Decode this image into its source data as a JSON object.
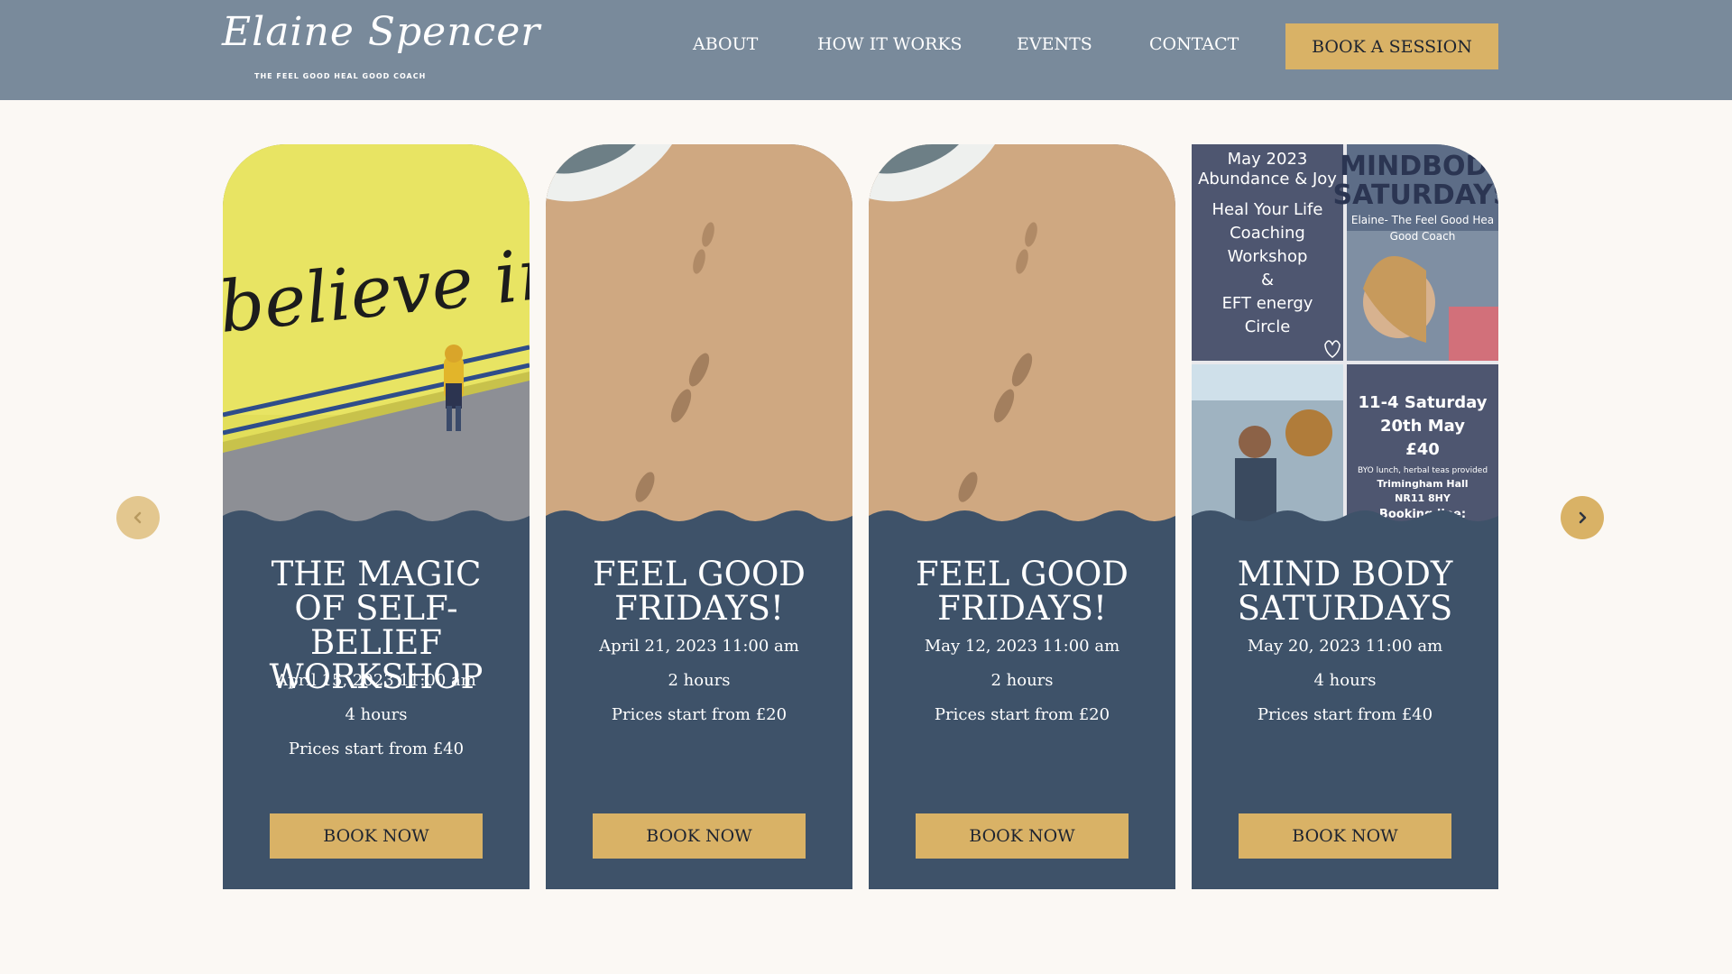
{
  "header": {
    "logo_script": "Elaine Spencer",
    "logo_tagline": "THE FEEL GOOD HEAL GOOD COACH",
    "nav": [
      "ABOUT",
      "HOW IT WORKS",
      "EVENTS",
      "CONTACT"
    ],
    "cta": "BOOK A SESSION"
  },
  "cards": [
    {
      "title": "THE MAGIC OF SELF-BELIEF WORKSHOP",
      "date": "April 15, 2023 11:00 am",
      "duration": "4 hours",
      "price": "Prices start from £40",
      "button": "BOOK NOW",
      "image_text": "believe in your"
    },
    {
      "title": "FEEL GOOD FRIDAYS!",
      "date": "April 21, 2023 11:00 am",
      "duration": "2 hours",
      "price": "Prices start from £20",
      "button": "BOOK NOW"
    },
    {
      "title": "FEEL GOOD FRIDAYS!",
      "date": "May 12, 2023 11:00 am",
      "duration": "2 hours",
      "price": "Prices start from £20",
      "button": "BOOK NOW"
    },
    {
      "title": "MIND BODY SATURDAYS",
      "date": "May 20, 2023 11:00 am",
      "duration": "4 hours",
      "price": "Prices start from £40",
      "button": "BOOK NOW",
      "poster": {
        "tl_line1": "May 2023",
        "tl_line2": "Abundance & Joy",
        "tl_body": [
          "Heal Your Life",
          "Coaching",
          "Workshop",
          "&",
          "EFT energy",
          "Circle"
        ],
        "tr_title1": "MINDBODY",
        "tr_title2": "SATURDAYS",
        "tr_sub1": "Elaine- The Feel Good Hea",
        "tr_sub2": "Good Coach",
        "br_line1": "11-4 Saturday",
        "br_line2": "20th May",
        "br_line3": "£40",
        "br_small1": "BYO lunch, herbal teas provided",
        "br_small2": "Trimingham Hall",
        "br_small3": "NR11 8HY",
        "br_small4": "Booking line:"
      }
    }
  ],
  "colors": {
    "header": "#798a9b",
    "card": "#3e5269",
    "accent": "#d9b266",
    "page": "#fbf8f4"
  },
  "icons": {
    "prev": "chevron-left-icon",
    "next": "chevron-right-icon"
  }
}
